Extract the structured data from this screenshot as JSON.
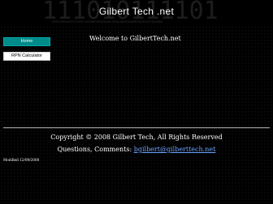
{
  "header": {
    "title": "Gilbert Tech .net",
    "binary_large": "111010111101",
    "binary_small": "0101110010101110101101010011010101011010100101010001101010111010001"
  },
  "nav": {
    "items": [
      {
        "label": "Home",
        "active": true
      },
      {
        "label": "RPN Calculator",
        "active": false
      }
    ]
  },
  "main": {
    "welcome": "Welcome to GilbertTech.net"
  },
  "footer": {
    "copyright": "Copyright © 2008 Gilbert Tech, All Rights Reserved",
    "contact_prefix": "Questions, Comments: ",
    "contact_email": "bgilbert@gilberttech.net",
    "modified": "Modified 12/09/2008"
  },
  "colors": {
    "background": "#000000",
    "nav_active": "#008b8b",
    "link": "#6aa3ff"
  }
}
